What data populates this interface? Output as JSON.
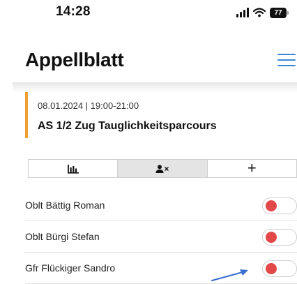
{
  "status_bar": {
    "time": "14:28",
    "battery": "77"
  },
  "header": {
    "title": "Appellblatt"
  },
  "event": {
    "datetime": "08.01.2024 | 19:00-21:00",
    "title": "AS 1/2 Zug Tauglichkeitsparcours",
    "accent_color": "#f0a030"
  },
  "tabs": [
    {
      "icon": "bar-chart-icon",
      "active": false
    },
    {
      "icon": "person-remove-icon",
      "active": true
    },
    {
      "icon": "plus-icon",
      "label": "+",
      "active": false
    }
  ],
  "persons": [
    {
      "name": "Oblt Bättig Roman",
      "present": false
    },
    {
      "name": "Oblt Bürgi Stefan",
      "present": false
    },
    {
      "name": "Gfr Flückiger Sandro",
      "present": false
    }
  ],
  "colors": {
    "accent": "#3a86d8",
    "toggle_off": "#e34848"
  }
}
